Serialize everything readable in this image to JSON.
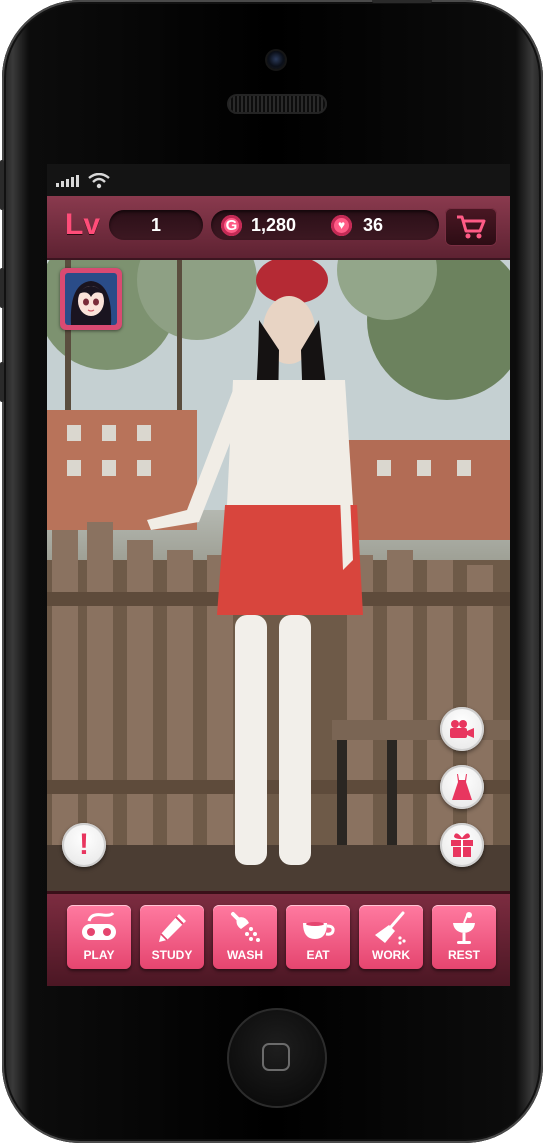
{
  "hud": {
    "level_label": "Lv",
    "level": "1",
    "gold": "1,280",
    "hearts": "36",
    "gold_icon_glyph": "G",
    "shop_icon": "cart-icon",
    "heart_icon": "heart-icon"
  },
  "status_bar": {
    "signal_icon": "signal-icon",
    "wifi_icon": "wifi-icon"
  },
  "side_actions": [
    {
      "icon": "video-camera-icon"
    },
    {
      "icon": "dress-icon"
    },
    {
      "icon": "gift-icon"
    }
  ],
  "alert": {
    "glyph": "!"
  },
  "actions": [
    {
      "label": "PLAY",
      "icon": "gamepad-icon"
    },
    {
      "label": "STUDY",
      "icon": "pencil-icon"
    },
    {
      "label": "WASH",
      "icon": "shower-icon"
    },
    {
      "label": "EAT",
      "icon": "cup-icon"
    },
    {
      "label": "WORK",
      "icon": "broom-icon"
    },
    {
      "label": "REST",
      "icon": "cocktail-icon"
    }
  ],
  "colors": {
    "accent": "#ff4d79",
    "button_top": "#ff7aa0",
    "button_bottom": "#e5456f",
    "bar_dark": "#4a1623"
  }
}
